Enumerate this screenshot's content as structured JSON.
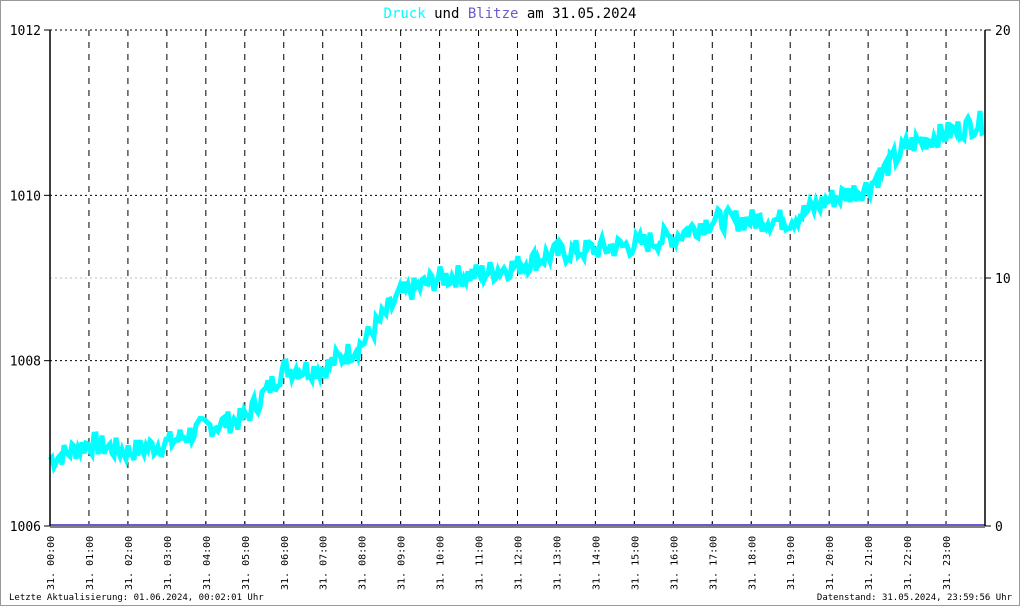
{
  "chart_data": {
    "type": "line",
    "title_parts": [
      {
        "text": "Druck",
        "color": "#00ffff"
      },
      {
        "text": " und ",
        "color": "#000000"
      },
      {
        "text": "Blitze",
        "color": "#6a5acd"
      },
      {
        "text": " am 31.05.2024",
        "color": "#000000"
      }
    ],
    "x_hours": [
      0,
      1,
      2,
      3,
      4,
      5,
      6,
      7,
      8,
      9,
      10,
      11,
      12,
      13,
      14,
      15,
      16,
      17,
      18,
      19,
      20,
      21,
      22,
      23,
      24
    ],
    "x_tick_labels": [
      "31. 00:00",
      "31. 01:00",
      "31. 02:00",
      "31. 03:00",
      "31. 04:00",
      "31. 05:00",
      "31. 06:00",
      "31. 07:00",
      "31. 08:00",
      "31. 09:00",
      "31. 10:00",
      "31. 11:00",
      "31. 12:00",
      "31. 13:00",
      "31. 14:00",
      "31. 15:00",
      "31. 16:00",
      "31. 17:00",
      "31. 18:00",
      "31. 19:00",
      "31. 20:00",
      "31. 21:00",
      "31. 22:00",
      "31. 23:00"
    ],
    "series": [
      {
        "name": "Druck",
        "axis": "left",
        "color": "#00ffff",
        "values": [
          1006.8,
          1007.0,
          1006.9,
          1007.0,
          1007.2,
          1007.3,
          1007.9,
          1007.9,
          1008.2,
          1008.8,
          1009.0,
          1009.05,
          1009.15,
          1009.3,
          1009.35,
          1009.4,
          1009.5,
          1009.7,
          1009.7,
          1009.7,
          1009.95,
          1010.1,
          1010.6,
          1010.75,
          1010.9
        ]
      },
      {
        "name": "Blitze",
        "axis": "right",
        "color": "#6a5acd",
        "values": [
          0,
          0,
          0,
          0,
          0,
          0,
          0,
          0,
          0,
          0,
          0,
          0,
          0,
          0,
          0,
          0,
          0,
          0,
          0,
          0,
          0,
          0,
          0,
          0,
          0
        ]
      }
    ],
    "left_axis": {
      "ylim": [
        1006,
        1012
      ],
      "ticks": [
        "1006",
        "1008",
        "1010",
        "1012"
      ]
    },
    "right_axis": {
      "ylim": [
        0,
        20
      ],
      "ticks": [
        "0",
        "10",
        "20"
      ]
    },
    "grid": true
  },
  "footer": {
    "left": "Letzte Aktualisierung: 01.06.2024, 00:02:01 Uhr",
    "right": "Datenstand: 31.05.2024, 23:59:56 Uhr"
  }
}
